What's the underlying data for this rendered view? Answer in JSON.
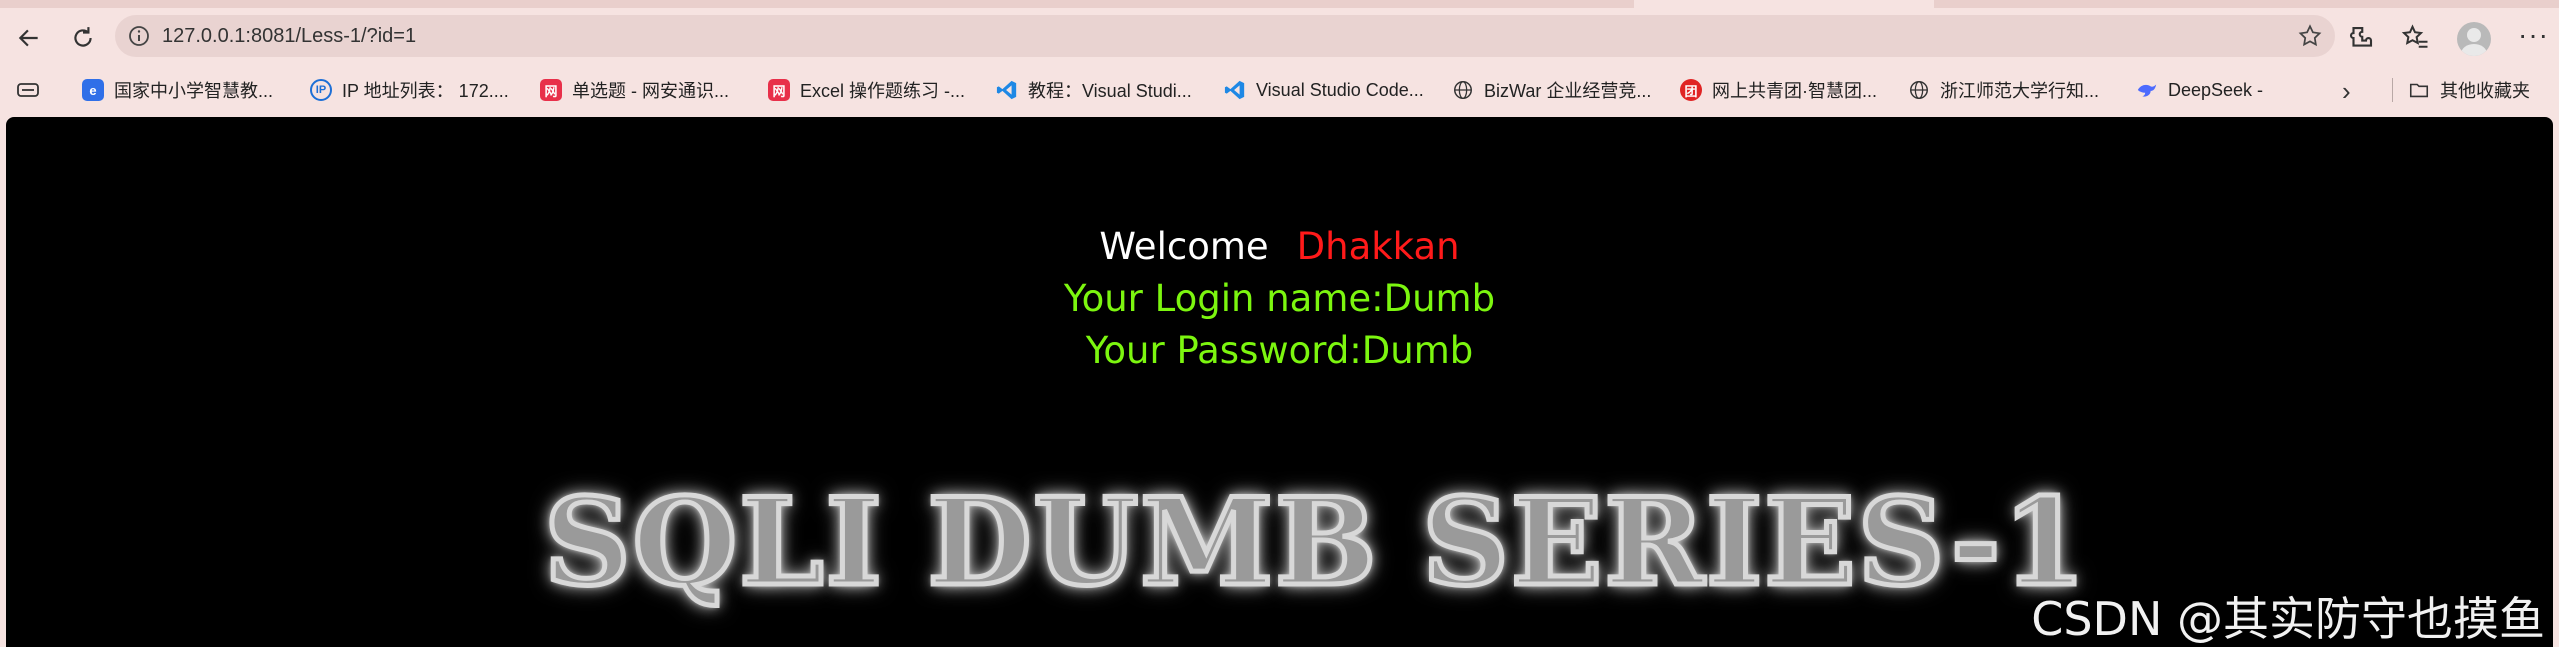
{
  "browser": {
    "url": "127.0.0.1:8081/Less-1/?id=1"
  },
  "bookmarks": [
    {
      "label": "国家中小学智慧教...",
      "icon": "smart-edu-icon",
      "color": "#2f6fe8"
    },
    {
      "label": "IP 地址列表： 172....",
      "icon": "ip-icon",
      "color": "#1d6fd6"
    },
    {
      "label": "单选题 - 网安通识...",
      "icon": "wangan-icon",
      "color": "#e8304a"
    },
    {
      "label": "Excel 操作题练习 -...",
      "icon": "wangan-icon",
      "color": "#e8304a"
    },
    {
      "label": "教程：Visual Studi...",
      "icon": "vscode-icon",
      "color": "#1e88e5"
    },
    {
      "label": "Visual Studio Code...",
      "icon": "vscode-icon",
      "color": "#1e88e5"
    },
    {
      "label": "BizWar 企业经营竞...",
      "icon": "globe-icon",
      "color": "#333333"
    },
    {
      "label": "网上共青团·智慧团...",
      "icon": "youth-league-icon",
      "color": "#e02424"
    },
    {
      "label": "浙江师范大学行知...",
      "icon": "globe-icon",
      "color": "#333333"
    },
    {
      "label": "DeepSeek -",
      "icon": "deepseek-icon",
      "color": "#4d6bfe"
    }
  ],
  "other_bookmarks": "其他收藏夹",
  "page": {
    "welcome": "Welcome",
    "name": "Dhakkan",
    "login_line": "Your Login name:Dumb",
    "password_line": "Your Password:Dumb",
    "banner": "SQLI DUMB SERIES-1",
    "watermark": "CSDN @其实防守也摸鱼"
  },
  "colors": {
    "page_bg": "#000000",
    "name": "#ff1a1a",
    "credentials": "#7cf60f",
    "chrome_bg": "#f6e3e1"
  }
}
